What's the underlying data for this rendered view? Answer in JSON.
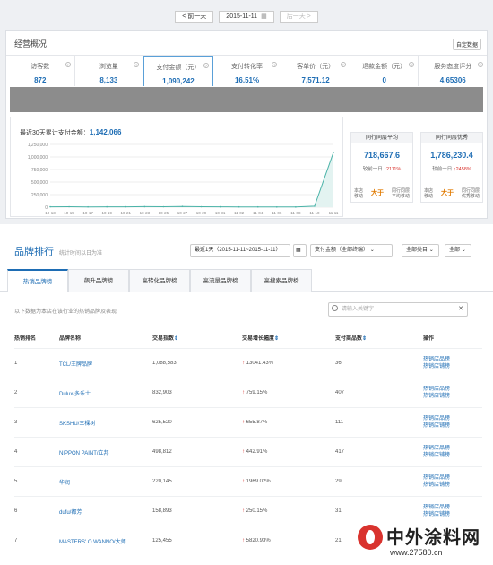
{
  "datebar": {
    "prev": "< 前一天",
    "date": "2015-11-11",
    "next": "后一天 >"
  },
  "overview": {
    "title": "经营概况",
    "mt_button": "自定数据",
    "kpis": [
      {
        "label": "访客数",
        "value": "872"
      },
      {
        "label": "浏览量",
        "value": "8,133"
      },
      {
        "label": "支付金额（元）",
        "value": "1,090,242"
      },
      {
        "label": "支付转化率",
        "value": "16.51%"
      },
      {
        "label": "客单价（元）",
        "value": "7,571.12"
      },
      {
        "label": "退款金额（元）",
        "value": "0"
      },
      {
        "label": "服务态度评分",
        "value": "4.65306"
      }
    ],
    "cumulative_label": "最近30天累计支付金额：",
    "cumulative_value": "1,142,066",
    "cards": [
      {
        "title": "同行同层平均",
        "value": "718,667.6",
        "compare_prefix": "较前一日",
        "compare": "↑2111%",
        "foot_left": "本店\n移动",
        "gt": "大于",
        "foot_right": "同行同层\n平均移动"
      },
      {
        "title": "同行同层优秀",
        "value": "1,786,230.4",
        "compare_prefix": "较前一日",
        "compare": "↑2458%",
        "foot_left": "本店\n移动",
        "gt": "大于",
        "foot_right": "同行同层\n优秀移动"
      }
    ]
  },
  "chart_data": {
    "type": "line",
    "title": "",
    "x": [
      "10-13",
      "10-15",
      "10-17",
      "10-19",
      "10-21",
      "10-23",
      "10-25",
      "10-27",
      "10-29",
      "10-31",
      "11-02",
      "11-04",
      "11-06",
      "11-08",
      "11-10",
      "11-11"
    ],
    "series": [
      {
        "values": [
          8000,
          9000,
          6000,
          7000,
          8000,
          10000,
          9000,
          14000,
          9000,
          7000,
          6000,
          5000,
          4000,
          3000,
          20000,
          1090242
        ]
      }
    ],
    "yticks": [
      "1,250,000",
      "1,000,000",
      "750,000",
      "500,000",
      "250,000",
      "0"
    ],
    "ylim": [
      0,
      1250000
    ],
    "grid": true
  },
  "brand": {
    "title": "品牌排行",
    "subtitle": "统计时间以日为准",
    "date_range": "最近1天（2015-11-11~2015-11-11）",
    "terminal": "支付金额（全部终端）",
    "category": "全部类目",
    "all": "全部",
    "tabs": [
      "热销品牌榜",
      "飙升品牌榜",
      "高转化品牌榜",
      "高流量品牌榜",
      "高搜索品牌榜"
    ],
    "note": "以下数据为本店在该行业的热销品牌及表现",
    "search_placeholder": "请输入关键字",
    "headers": [
      "热销排名",
      "品牌名称",
      "交易指数",
      "交易增长幅度",
      "支付商品数",
      "操作"
    ],
    "sort_mark": "⇕",
    "rows": [
      {
        "rank": "1",
        "name": "TCL/王牌品牌",
        "index": "1,088,583",
        "growth": "13041.43%",
        "count": "36"
      },
      {
        "rank": "2",
        "name": "Dulux/多乐士",
        "index": "832,903",
        "growth": "759.15%",
        "count": "407"
      },
      {
        "rank": "3",
        "name": "SKSHU/三棵树",
        "index": "625,520",
        "growth": "655.87%",
        "count": "111"
      },
      {
        "rank": "4",
        "name": "NIPPON PAINT/立邦",
        "index": "498,812",
        "growth": "442.91%",
        "count": "417"
      },
      {
        "rank": "5",
        "name": "华润",
        "index": "220,145",
        "growth": "1969.02%",
        "count": "29"
      },
      {
        "rank": "6",
        "name": "dufu/都芳",
        "index": "158,893",
        "growth": "250.15%",
        "count": "31"
      },
      {
        "rank": "7",
        "name": "MASTERS' O WANNO/大师",
        "index": "125,455",
        "growth": "5820.93%",
        "count": "21"
      }
    ],
    "op1": "热销店品榜",
    "op2": "热销店铺榜"
  },
  "watermark": {
    "text": "中外涂料网",
    "url": "www.27580.cn"
  }
}
